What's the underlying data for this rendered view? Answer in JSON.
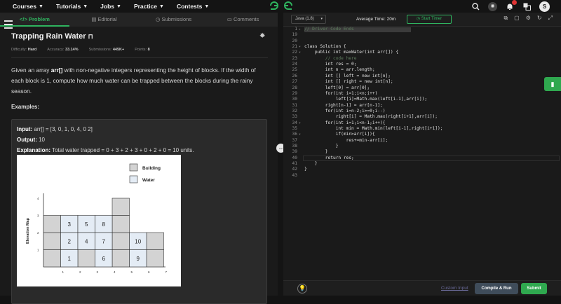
{
  "nav": {
    "items": [
      "Courses",
      "Tutorials",
      "Jobs",
      "Practice",
      "Contests"
    ],
    "avatar_letter": "S"
  },
  "tabs": [
    {
      "label": "Problem",
      "icon": "code-icon",
      "active": true
    },
    {
      "label": "Editorial",
      "icon": "editorial-icon",
      "active": false
    },
    {
      "label": "Submissions",
      "icon": "submissions-icon",
      "active": false
    },
    {
      "label": "Comments",
      "icon": "comments-icon",
      "active": false
    }
  ],
  "problem": {
    "title": "Trapping Rain Water",
    "difficulty_label": "Difficulty:",
    "difficulty": "Hard",
    "accuracy_label": "Accuracy:",
    "accuracy": "33.14%",
    "submissions_label": "Submissions:",
    "submissions": "445K+",
    "points_label": "Points:",
    "points": "8",
    "desc_pre": "Given an array ",
    "desc_bold": "arr[]",
    "desc_post": " with non-negative integers representing the height of blocks. If the width of each block is 1, compute how much water can be trapped between the blocks during the rainy season.",
    "examples_heading": "Examples:",
    "example": {
      "input_label": "Input:",
      "input": "arr[] = [3, 0, 1, 0, 4, 0 2]",
      "output_label": "Output:",
      "output": "10",
      "explanation_label": "Explanation:",
      "explanation": "Total water trapped = 0 + 3 + 2 + 3 + 0 + 2 + 0 = 10 units."
    }
  },
  "diagram": {
    "legend": [
      "Building",
      "Water"
    ],
    "y_axis_label": "Elevation Map",
    "x_ticks": [
      "1",
      "2",
      "3",
      "4",
      "5",
      "6",
      "7"
    ],
    "y_ticks": [
      "1",
      "2",
      "3",
      "4"
    ],
    "water_labels": [
      "3",
      "5",
      "8",
      "2",
      "4",
      "7",
      "10",
      "1",
      "6",
      "9"
    ]
  },
  "editor": {
    "language": "Java (1.8)",
    "average_time": "Average Time: 20m",
    "timer_label": "Start Timer",
    "lines": [
      {
        "n": "1",
        "fold": "▸",
        "text": "// Driver Code Ends",
        "cls": "cm",
        "hl": true
      },
      {
        "n": "19",
        "fold": "",
        "text": "",
        "cls": ""
      },
      {
        "n": "20",
        "fold": "",
        "text": "",
        "cls": ""
      },
      {
        "n": "21",
        "fold": "▾",
        "text": "class Solution {",
        "cls": ""
      },
      {
        "n": "22",
        "fold": "▾",
        "text": "    public int maxWater(int arr[]) {",
        "cls": ""
      },
      {
        "n": "23",
        "fold": "",
        "text": "        // code here",
        "cls": "cm"
      },
      {
        "n": "24",
        "fold": "",
        "text": "        int res = 0;",
        "cls": ""
      },
      {
        "n": "25",
        "fold": "",
        "text": "        int n = arr.length;",
        "cls": ""
      },
      {
        "n": "26",
        "fold": "",
        "text": "        int [] left = new int[n];",
        "cls": ""
      },
      {
        "n": "27",
        "fold": "",
        "text": "        int [] right = new int[n];",
        "cls": ""
      },
      {
        "n": "28",
        "fold": "",
        "text": "        left[0] = arr[0];",
        "cls": ""
      },
      {
        "n": "29",
        "fold": "",
        "text": "        for(int i=1;i<n;i++)",
        "cls": ""
      },
      {
        "n": "30",
        "fold": "",
        "text": "            left[i]=Math.max(left[i-1],arr[i]);",
        "cls": ""
      },
      {
        "n": "31",
        "fold": "",
        "text": "        right[n-1] = arr[n-1];",
        "cls": ""
      },
      {
        "n": "32",
        "fold": "",
        "text": "        for(int i=n-2;i>=0;i--)",
        "cls": ""
      },
      {
        "n": "33",
        "fold": "",
        "text": "            right[i] = Math.max(right[i+1],arr[i]);",
        "cls": ""
      },
      {
        "n": "34",
        "fold": "▾",
        "text": "        for(int i=1;i<n-1;i++){",
        "cls": ""
      },
      {
        "n": "35",
        "fold": "",
        "text": "            int min = Math.min(left[i-1],right[i+1]);",
        "cls": ""
      },
      {
        "n": "36",
        "fold": "▾",
        "text": "            if(min>arr[i]){",
        "cls": ""
      },
      {
        "n": "37",
        "fold": "",
        "text": "                res+=min-arr[i];",
        "cls": ""
      },
      {
        "n": "38",
        "fold": "",
        "text": "            }",
        "cls": ""
      },
      {
        "n": "39",
        "fold": "",
        "text": "        }",
        "cls": ""
      },
      {
        "n": "40",
        "fold": "",
        "text": "        return res;",
        "cls": "",
        "cursor": true
      },
      {
        "n": "41",
        "fold": "",
        "text": "    }",
        "cls": ""
      },
      {
        "n": "42",
        "fold": "",
        "text": "}",
        "cls": ""
      },
      {
        "n": "43",
        "fold": "",
        "text": "",
        "cls": ""
      }
    ],
    "custom_input": "Custom Input",
    "compile_label": "Compile & Run",
    "submit_label": "Submit"
  },
  "colors": {
    "accent": "#2fb45f",
    "background": "#1a1a1a",
    "submit": "#2fa84f"
  }
}
